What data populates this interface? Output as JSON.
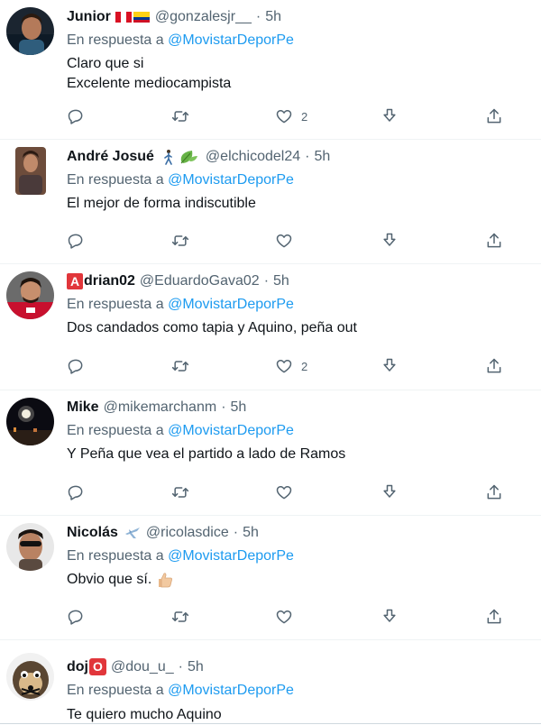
{
  "colors": {
    "accent": "#1d9bf0",
    "muted": "#536471",
    "text": "#0f1419"
  },
  "icons": {
    "reply": "reply-icon",
    "retweet": "retweet-icon",
    "like": "heart-icon",
    "download": "download-icon",
    "share": "share-icon"
  },
  "tweets": [
    {
      "name": "Junior",
      "emoji": "flags-peru-colombia",
      "handle": "@gonzalesjr__",
      "sep": "·",
      "time": "5h",
      "reply_prefix": "En respuesta a",
      "mention": "@MovistarDeporPe",
      "lines": [
        "Claro que si",
        "Excelente mediocampista"
      ],
      "likes": "2"
    },
    {
      "name": "André Josué",
      "emoji": "person-leaf",
      "handle": "@elchicodel24",
      "sep": "·",
      "time": "5h",
      "reply_prefix": "En respuesta a",
      "mention": "@MovistarDeporPe",
      "lines": [
        "El mejor de forma indiscutible"
      ],
      "likes": ""
    },
    {
      "name_badge": "A",
      "name": "drian02",
      "handle": "@EduardoGava02",
      "sep": "·",
      "time": "5h",
      "reply_prefix": "En respuesta a",
      "mention": "@MovistarDeporPe",
      "lines": [
        "Dos candados como tapia y Aquino, peña out"
      ],
      "likes": "2"
    },
    {
      "name": "Mike",
      "handle": "@mikemarchanm",
      "sep": "·",
      "time": "5h",
      "reply_prefix": "En respuesta a",
      "mention": "@MovistarDeporPe",
      "lines": [
        "Y Peña que vea el partido a lado de Ramos"
      ],
      "likes": ""
    },
    {
      "name": "Nicolás",
      "emoji": "airplane",
      "handle": "@ricolasdice",
      "sep": "·",
      "time": "5h",
      "reply_prefix": "En respuesta a",
      "mention": "@MovistarDeporPe",
      "lines": [
        "Obvio que sí."
      ],
      "likes": ""
    },
    {
      "name": "doj",
      "name_badge_after": "O",
      "handle": "@dou_u_",
      "sep": "·",
      "time": "5h",
      "reply_prefix": "En respuesta a",
      "mention": "@MovistarDeporPe",
      "lines": [
        "Te quiero mucho Aquino"
      ]
    }
  ]
}
